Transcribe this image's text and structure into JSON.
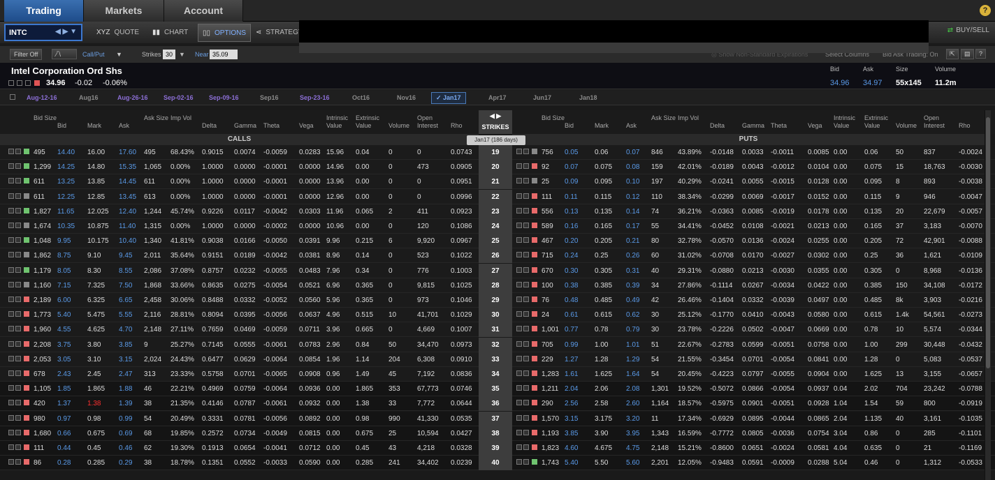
{
  "nav": {
    "tabs": [
      "Trading",
      "Markets",
      "Account"
    ]
  },
  "toolbar": {
    "symbol": "INTC",
    "quote": "QUOTE",
    "chart": "CHART",
    "options": "OPTIONS",
    "strategy": "STRATEGY",
    "buysell": "BUY/SELL"
  },
  "filters": {
    "filter_off": "Filter Off",
    "callput": "Call/Put",
    "strikes_label": "Strikes",
    "strikes_value": "30",
    "near_label": "Near",
    "near_value": "35.09",
    "nonstd": "Show Non-Standard Expirations",
    "select_columns": "Select Columns",
    "bid_ask": "Bid Ask Trading: On"
  },
  "quote": {
    "name": "Intel Corporation Ord Shs",
    "last": "34.96",
    "change": "-0.02",
    "pct": "-0.06%",
    "bid_label": "Bid",
    "ask_label": "Ask",
    "size_label": "Size",
    "volume_label": "Volume",
    "bid": "34.96",
    "ask": "34.97",
    "size": "55x145",
    "volume": "11.2m"
  },
  "expirations": [
    {
      "label": "Aug-12-16",
      "weekly": true
    },
    {
      "label": "Aug16",
      "weekly": false
    },
    {
      "label": "Aug-26-16",
      "weekly": true
    },
    {
      "label": "Sep-02-16",
      "weekly": true
    },
    {
      "label": "Sep-09-16",
      "weekly": true
    },
    {
      "label": "Sep16",
      "weekly": false
    },
    {
      "label": "Sep-23-16",
      "weekly": true
    },
    {
      "label": "Oct16",
      "weekly": false
    },
    {
      "label": "Nov16",
      "weekly": false
    },
    {
      "label": "Jan17",
      "weekly": false,
      "selected": true
    },
    {
      "label": "Apr17",
      "weekly": false
    },
    {
      "label": "Jun17",
      "weekly": false
    },
    {
      "label": "Jan18",
      "weekly": false
    }
  ],
  "headers": {
    "calls": [
      "Bid Size",
      "Bid",
      "Mark",
      "Ask",
      "Ask Size",
      "Imp Vol",
      "Delta",
      "Gamma",
      "Theta",
      "Vega",
      "Intrinsic Value",
      "Extrinsic Value",
      "Volume",
      "Open Interest",
      "Rho"
    ],
    "strikes": "STRIKES",
    "puts": [
      "Bid Size",
      "Bid",
      "Mark",
      "Ask",
      "Ask Size",
      "Imp Vol",
      "Delta",
      "Gamma",
      "Theta",
      "Vega",
      "Intrinsic Value",
      "Extrinsic Value",
      "Volume",
      "Open Interest",
      "Rho"
    ],
    "calls_title": "CALLS",
    "puts_title": "PUTS",
    "exp_badge": "Jan17   (186 days)"
  },
  "rows": [
    {
      "strike": "19",
      "call": [
        "495",
        "14.40",
        "16.00",
        "17.60",
        "495",
        "68.43%",
        "0.9015",
        "0.0074",
        "-0.0059",
        "0.0283",
        "15.96",
        "0.04",
        "0",
        "0",
        "0.0743"
      ],
      "cflag": "green",
      "put": [
        "756",
        "0.05",
        "0.06",
        "0.07",
        "846",
        "43.89%",
        "-0.0148",
        "0.0033",
        "-0.0011",
        "0.0085",
        "0.00",
        "0.06",
        "50",
        "837",
        "-0.0024"
      ],
      "pflag": "grey"
    },
    {
      "strike": "20",
      "call": [
        "1,299",
        "14.25",
        "14.80",
        "15.35",
        "1,065",
        "0.00%",
        "1.0000",
        "0.0000",
        "-0.0001",
        "0.0000",
        "14.96",
        "0.00",
        "0",
        "473",
        "0.0905"
      ],
      "cflag": "green",
      "put": [
        "92",
        "0.07",
        "0.075",
        "0.08",
        "159",
        "42.01%",
        "-0.0189",
        "0.0043",
        "-0.0012",
        "0.0104",
        "0.00",
        "0.075",
        "15",
        "18,763",
        "-0.0030"
      ],
      "pflag": "red"
    },
    {
      "strike": "21",
      "call": [
        "611",
        "13.25",
        "13.85",
        "14.45",
        "611",
        "0.00%",
        "1.0000",
        "0.0000",
        "-0.0001",
        "0.0000",
        "13.96",
        "0.00",
        "0",
        "0",
        "0.0951"
      ],
      "cflag": "green",
      "put": [
        "25",
        "0.09",
        "0.095",
        "0.10",
        "197",
        "40.29%",
        "-0.0241",
        "0.0055",
        "-0.0015",
        "0.0128",
        "0.00",
        "0.095",
        "8",
        "893",
        "-0.0038"
      ],
      "pflag": "grey"
    },
    {
      "strike": "22",
      "call": [
        "611",
        "12.25",
        "12.85",
        "13.45",
        "613",
        "0.00%",
        "1.0000",
        "0.0000",
        "-0.0001",
        "0.0000",
        "12.96",
        "0.00",
        "0",
        "0",
        "0.0996"
      ],
      "cflag": "grey",
      "put": [
        "111",
        "0.11",
        "0.115",
        "0.12",
        "110",
        "38.34%",
        "-0.0299",
        "0.0069",
        "-0.0017",
        "0.0152",
        "0.00",
        "0.115",
        "9",
        "946",
        "-0.0047"
      ],
      "pflag": "red"
    },
    {
      "strike": "23",
      "call": [
        "1,827",
        "11.65",
        "12.025",
        "12.40",
        "1,244",
        "45.74%",
        "0.9226",
        "0.0117",
        "-0.0042",
        "0.0303",
        "11.96",
        "0.065",
        "2",
        "411",
        "0.0923"
      ],
      "cflag": "green",
      "put": [
        "556",
        "0.13",
        "0.135",
        "0.14",
        "74",
        "36.21%",
        "-0.0363",
        "0.0085",
        "-0.0019",
        "0.0178",
        "0.00",
        "0.135",
        "20",
        "22,679",
        "-0.0057"
      ],
      "pflag": "red"
    },
    {
      "strike": "24",
      "call": [
        "1,674",
        "10.35",
        "10.875",
        "11.40",
        "1,315",
        "0.00%",
        "1.0000",
        "0.0000",
        "-0.0002",
        "0.0000",
        "10.96",
        "0.00",
        "0",
        "120",
        "0.1086"
      ],
      "cflag": "grey",
      "put": [
        "589",
        "0.16",
        "0.165",
        "0.17",
        "55",
        "34.41%",
        "-0.0452",
        "0.0108",
        "-0.0021",
        "0.0213",
        "0.00",
        "0.165",
        "37",
        "3,183",
        "-0.0070"
      ],
      "pflag": "red"
    },
    {
      "strike": "25",
      "call": [
        "1,048",
        "9.95",
        "10.175",
        "10.40",
        "1,340",
        "41.81%",
        "0.9038",
        "0.0166",
        "-0.0050",
        "0.0391",
        "9.96",
        "0.215",
        "6",
        "9,920",
        "0.0967"
      ],
      "cflag": "green",
      "put": [
        "467",
        "0.20",
        "0.205",
        "0.21",
        "80",
        "32.78%",
        "-0.0570",
        "0.0136",
        "-0.0024",
        "0.0255",
        "0.00",
        "0.205",
        "72",
        "42,901",
        "-0.0088"
      ],
      "pflag": "red"
    },
    {
      "strike": "26",
      "call": [
        "1,862",
        "8.75",
        "9.10",
        "9.45",
        "2,011",
        "35.64%",
        "0.9151",
        "0.0189",
        "-0.0042",
        "0.0381",
        "8.96",
        "0.14",
        "0",
        "523",
        "0.1022"
      ],
      "cflag": "grey",
      "put": [
        "715",
        "0.24",
        "0.25",
        "0.26",
        "60",
        "31.02%",
        "-0.0708",
        "0.0170",
        "-0.0027",
        "0.0302",
        "0.00",
        "0.25",
        "36",
        "1,621",
        "-0.0109"
      ],
      "pflag": "red"
    },
    {
      "strike": "27",
      "call": [
        "1,179",
        "8.05",
        "8.30",
        "8.55",
        "2,086",
        "37.08%",
        "0.8757",
        "0.0232",
        "-0.0055",
        "0.0483",
        "7.96",
        "0.34",
        "0",
        "776",
        "0.1003"
      ],
      "cflag": "green",
      "put": [
        "670",
        "0.30",
        "0.305",
        "0.31",
        "40",
        "29.31%",
        "-0.0880",
        "0.0213",
        "-0.0030",
        "0.0355",
        "0.00",
        "0.305",
        "0",
        "8,968",
        "-0.0136"
      ],
      "pflag": "red"
    },
    {
      "strike": "28",
      "call": [
        "1,160",
        "7.15",
        "7.325",
        "7.50",
        "1,868",
        "33.66%",
        "0.8635",
        "0.0275",
        "-0.0054",
        "0.0521",
        "6.96",
        "0.365",
        "0",
        "9,815",
        "0.1025"
      ],
      "cflag": "grey",
      "put": [
        "100",
        "0.38",
        "0.385",
        "0.39",
        "34",
        "27.86%",
        "-0.1114",
        "0.0267",
        "-0.0034",
        "0.0422",
        "0.00",
        "0.385",
        "150",
        "34,108",
        "-0.0172"
      ],
      "pflag": "red"
    },
    {
      "strike": "29",
      "call": [
        "2,189",
        "6.00",
        "6.325",
        "6.65",
        "2,458",
        "30.06%",
        "0.8488",
        "0.0332",
        "-0.0052",
        "0.0560",
        "5.96",
        "0.365",
        "0",
        "973",
        "0.1046"
      ],
      "cflag": "red",
      "put": [
        "76",
        "0.48",
        "0.485",
        "0.49",
        "42",
        "26.46%",
        "-0.1404",
        "0.0332",
        "-0.0039",
        "0.0497",
        "0.00",
        "0.485",
        "8k",
        "3,903",
        "-0.0216"
      ],
      "pflag": "red"
    },
    {
      "strike": "30",
      "call": [
        "1,773",
        "5.40",
        "5.475",
        "5.55",
        "2,116",
        "28.81%",
        "0.8094",
        "0.0395",
        "-0.0056",
        "0.0637",
        "4.96",
        "0.515",
        "10",
        "41,701",
        "0.1029"
      ],
      "cflag": "red",
      "put": [
        "24",
        "0.61",
        "0.615",
        "0.62",
        "30",
        "25.12%",
        "-0.1770",
        "0.0410",
        "-0.0043",
        "0.0580",
        "0.00",
        "0.615",
        "1.4k",
        "54,561",
        "-0.0273"
      ],
      "pflag": "red"
    },
    {
      "strike": "31",
      "call": [
        "1,960",
        "4.55",
        "4.625",
        "4.70",
        "2,148",
        "27.11%",
        "0.7659",
        "0.0469",
        "-0.0059",
        "0.0711",
        "3.96",
        "0.665",
        "0",
        "4,669",
        "0.1007"
      ],
      "cflag": "red",
      "put": [
        "1,001",
        "0.77",
        "0.78",
        "0.79",
        "30",
        "23.78%",
        "-0.2226",
        "0.0502",
        "-0.0047",
        "0.0669",
        "0.00",
        "0.78",
        "10",
        "5,574",
        "-0.0344"
      ],
      "pflag": "red"
    },
    {
      "strike": "32",
      "call": [
        "2,208",
        "3.75",
        "3.80",
        "3.85",
        "9",
        "25.27%",
        "0.7145",
        "0.0555",
        "-0.0061",
        "0.0783",
        "2.96",
        "0.84",
        "50",
        "34,470",
        "0.0973"
      ],
      "cflag": "red",
      "put": [
        "705",
        "0.99",
        "1.00",
        "1.01",
        "51",
        "22.67%",
        "-0.2783",
        "0.0599",
        "-0.0051",
        "0.0758",
        "0.00",
        "1.00",
        "299",
        "30,448",
        "-0.0432"
      ],
      "pflag": "red"
    },
    {
      "strike": "33",
      "call": [
        "2,053",
        "3.05",
        "3.10",
        "3.15",
        "2,024",
        "24.43%",
        "0.6477",
        "0.0629",
        "-0.0064",
        "0.0854",
        "1.96",
        "1.14",
        "204",
        "6,308",
        "0.0910"
      ],
      "cflag": "red",
      "put": [
        "229",
        "1.27",
        "1.28",
        "1.29",
        "54",
        "21.55%",
        "-0.3454",
        "0.0701",
        "-0.0054",
        "0.0841",
        "0.00",
        "1.28",
        "0",
        "5,083",
        "-0.0537"
      ],
      "pflag": "red"
    },
    {
      "strike": "34",
      "call": [
        "678",
        "2.43",
        "2.45",
        "2.47",
        "313",
        "23.33%",
        "0.5758",
        "0.0701",
        "-0.0065",
        "0.0908",
        "0.96",
        "1.49",
        "45",
        "7,192",
        "0.0836"
      ],
      "cflag": "red",
      "put": [
        "1,283",
        "1.61",
        "1.625",
        "1.64",
        "54",
        "20.45%",
        "-0.4223",
        "0.0797",
        "-0.0055",
        "0.0904",
        "0.00",
        "1.625",
        "13",
        "3,155",
        "-0.0657"
      ],
      "pflag": "red"
    },
    {
      "strike": "35",
      "call": [
        "1,105",
        "1.85",
        "1.865",
        "1.88",
        "46",
        "22.21%",
        "0.4969",
        "0.0759",
        "-0.0064",
        "0.0936",
        "0.00",
        "1.865",
        "353",
        "67,773",
        "0.0746"
      ],
      "cflag": "red",
      "put": [
        "1,211",
        "2.04",
        "2.06",
        "2.08",
        "1,301",
        "19.52%",
        "-0.5072",
        "0.0866",
        "-0.0054",
        "0.0937",
        "0.04",
        "2.02",
        "704",
        "23,242",
        "-0.0788"
      ],
      "pflag": "red"
    },
    {
      "strike": "36",
      "call": [
        "420",
        "1.37",
        "1.38",
        "1.39",
        "38",
        "21.35%",
        "0.4146",
        "0.0787",
        "-0.0061",
        "0.0932",
        "0.00",
        "1.38",
        "33",
        "7,772",
        "0.0644"
      ],
      "cflag": "red",
      "markred": true,
      "put": [
        "290",
        "2.56",
        "2.58",
        "2.60",
        "1,164",
        "18.57%",
        "-0.5975",
        "0.0901",
        "-0.0051",
        "0.0928",
        "1.04",
        "1.54",
        "59",
        "800",
        "-0.0919"
      ],
      "pflag": "red"
    },
    {
      "strike": "37",
      "call": [
        "980",
        "0.97",
        "0.98",
        "0.99",
        "54",
        "20.49%",
        "0.3331",
        "0.0781",
        "-0.0056",
        "0.0892",
        "0.00",
        "0.98",
        "990",
        "41,330",
        "0.0535"
      ],
      "cflag": "red",
      "put": [
        "1,570",
        "3.15",
        "3.175",
        "3.20",
        "11",
        "17.34%",
        "-0.6929",
        "0.0895",
        "-0.0044",
        "0.0865",
        "2.04",
        "1.135",
        "40",
        "3,161",
        "-0.1035"
      ],
      "pflag": "red"
    },
    {
      "strike": "38",
      "call": [
        "1,680",
        "0.66",
        "0.675",
        "0.69",
        "68",
        "19.85%",
        "0.2572",
        "0.0734",
        "-0.0049",
        "0.0815",
        "0.00",
        "0.675",
        "25",
        "10,594",
        "0.0427"
      ],
      "cflag": "red",
      "put": [
        "1,193",
        "3.85",
        "3.90",
        "3.95",
        "1,343",
        "16.59%",
        "-0.7772",
        "0.0805",
        "-0.0036",
        "0.0754",
        "3.04",
        "0.86",
        "0",
        "285",
        "-0.1101"
      ],
      "pflag": "red"
    },
    {
      "strike": "39",
      "call": [
        "111",
        "0.44",
        "0.45",
        "0.46",
        "62",
        "19.30%",
        "0.1913",
        "0.0654",
        "-0.0041",
        "0.0712",
        "0.00",
        "0.45",
        "43",
        "4,218",
        "0.0328"
      ],
      "cflag": "red",
      "put": [
        "1,823",
        "4.60",
        "4.675",
        "4.75",
        "2,148",
        "15.21%",
        "-0.8600",
        "0.0651",
        "-0.0024",
        "0.0581",
        "4.04",
        "0.635",
        "0",
        "21",
        "-0.1169"
      ],
      "pflag": "red"
    },
    {
      "strike": "40",
      "call": [
        "86",
        "0.28",
        "0.285",
        "0.29",
        "38",
        "18.78%",
        "0.1351",
        "0.0552",
        "-0.0033",
        "0.0590",
        "0.00",
        "0.285",
        "241",
        "34,402",
        "0.0239"
      ],
      "cflag": "red",
      "put": [
        "1,743",
        "5.40",
        "5.50",
        "5.60",
        "2,201",
        "12.05%",
        "-0.9483",
        "0.0591",
        "-0.0009",
        "0.0288",
        "5.04",
        "0.46",
        "0",
        "1,312",
        "-0.0533"
      ],
      "pflag": "green"
    }
  ]
}
